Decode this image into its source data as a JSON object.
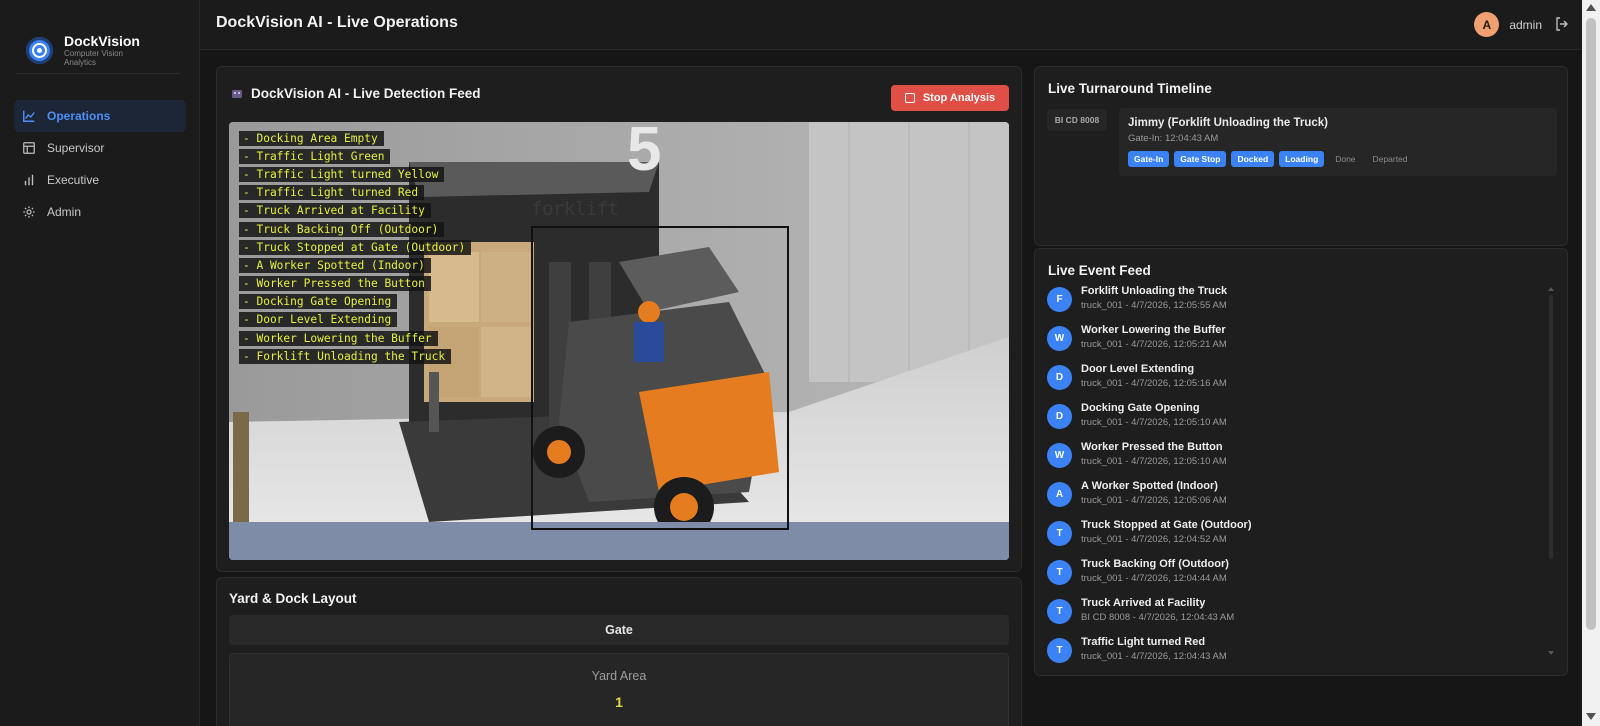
{
  "brand": {
    "name": "DockVision",
    "subtitle": "Computer Vision Analytics"
  },
  "sidebar": {
    "items": [
      {
        "label": "Operations",
        "icon": "chart-line-icon",
        "active": true
      },
      {
        "label": "Supervisor",
        "icon": "dashboard-icon",
        "active": false
      },
      {
        "label": "Executive",
        "icon": "bar-chart-icon",
        "active": false
      },
      {
        "label": "Admin",
        "icon": "gear-icon",
        "active": false
      }
    ]
  },
  "header": {
    "title": "DockVision AI - Live Operations",
    "user_initial": "A",
    "username": "admin"
  },
  "feed": {
    "title": "DockVision AI - Live Detection Feed",
    "stop_label": "Stop Analysis",
    "object_label": "forklift",
    "detections": [
      "- Docking Area Empty",
      "- Traffic Light Green",
      "- Traffic Light turned Yellow",
      "- Traffic Light turned Red",
      "- Truck Arrived at Facility",
      "- Truck Backing Off (Outdoor)",
      "- Truck Stopped at Gate (Outdoor)",
      "- A Worker Spotted (Indoor)",
      "- Worker Pressed the Button",
      "- Docking Gate Opening",
      "- Door Level Extending",
      "- Worker Lowering the Buffer",
      "- Forklift Unloading the Truck"
    ]
  },
  "yard": {
    "title": "Yard & Dock Layout",
    "gate_label": "Gate",
    "area_label": "Yard Area",
    "area_count": "1"
  },
  "timeline": {
    "title": "Live Turnaround Timeline",
    "truck_id": "BI CD 8008",
    "name": "Jimmy (Forklift Unloading the Truck)",
    "gate_in": "Gate-In: 12:04:43 AM",
    "stages": [
      {
        "label": "Gate-In",
        "done": true
      },
      {
        "label": "Gate Stop",
        "done": true
      },
      {
        "label": "Docked",
        "done": true
      },
      {
        "label": "Loading",
        "done": true
      },
      {
        "label": "Done",
        "done": false
      },
      {
        "label": "Departed",
        "done": false
      }
    ]
  },
  "events": {
    "title": "Live Event Feed",
    "items": [
      {
        "initial": "F",
        "title": "Forklift Unloading the Truck",
        "sub": "truck_001 - 4/7/2026, 12:05:55 AM"
      },
      {
        "initial": "W",
        "title": "Worker Lowering the Buffer",
        "sub": "truck_001 - 4/7/2026, 12:05:21 AM"
      },
      {
        "initial": "D",
        "title": "Door Level Extending",
        "sub": "truck_001 - 4/7/2026, 12:05:16 AM"
      },
      {
        "initial": "D",
        "title": "Docking Gate Opening",
        "sub": "truck_001 - 4/7/2026, 12:05:10 AM"
      },
      {
        "initial": "W",
        "title": "Worker Pressed the Button",
        "sub": "truck_001 - 4/7/2026, 12:05:10 AM"
      },
      {
        "initial": "A",
        "title": "A Worker Spotted (Indoor)",
        "sub": "truck_001 - 4/7/2026, 12:05:06 AM"
      },
      {
        "initial": "T",
        "title": "Truck Stopped at Gate (Outdoor)",
        "sub": "truck_001 - 4/7/2026, 12:04:52 AM"
      },
      {
        "initial": "T",
        "title": "Truck Backing Off (Outdoor)",
        "sub": "truck_001 - 4/7/2026, 12:04:44 AM"
      },
      {
        "initial": "T",
        "title": "Truck Arrived at Facility",
        "sub": "BI CD 8008 - 4/7/2026, 12:04:43 AM"
      },
      {
        "initial": "T",
        "title": "Traffic Light turned Red",
        "sub": "truck_001 - 4/7/2026, 12:04:43 AM"
      }
    ]
  },
  "colors": {
    "accent": "#3b82f6",
    "danger": "#e04f45",
    "detection_text": "#e6f23a",
    "background": "#161616"
  }
}
